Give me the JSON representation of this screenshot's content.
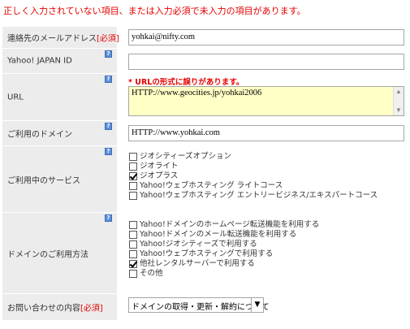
{
  "error_message": "正しく入力されていない項目、または入力必須で未入力の項目があります。",
  "required_mark": "[必須]",
  "help_glyph": "?",
  "fields": {
    "email": {
      "label": "連絡先のメールアドレス",
      "value": "yohkai@nifty.com"
    },
    "yahoo_id": {
      "label": "Yahoo! JAPAN ID",
      "value": ""
    },
    "url": {
      "label": "URL",
      "error": "* URLの形式に誤りがあります。",
      "value": "HTTP://www.geocities.jp/yohkai2006"
    },
    "domain": {
      "label": "ご利用のドメイン",
      "value": "HTTP://www.yohkai.com"
    },
    "services": {
      "label": "ご利用中のサービス",
      "options": [
        {
          "label": "ジオシティーズオプション",
          "checked": false
        },
        {
          "label": "ジオライト",
          "checked": false
        },
        {
          "label": "ジオプラス",
          "checked": true
        },
        {
          "label": "Yahoo!ウェブホスティング ライトコース",
          "checked": false
        },
        {
          "label": "Yahoo!ウェブホスティング エントリービジネス/エキスパートコース",
          "checked": false
        }
      ]
    },
    "domain_usage": {
      "label": "ドメインのご利用方法",
      "options": [
        {
          "label": "Yahoo!ドメインのホームページ転送機能を利用する",
          "checked": false
        },
        {
          "label": "Yahoo!ドメインのメール転送機能を利用する",
          "checked": false
        },
        {
          "label": "Yahoo!ジオシティーズで利用する",
          "checked": false
        },
        {
          "label": "Yahoo!ウェブホスティングで利用する",
          "checked": false
        },
        {
          "label": "他社レンタルサーバーで利用する",
          "checked": true
        },
        {
          "label": "その他",
          "checked": false
        }
      ]
    },
    "inquiry": {
      "label": "お問い合わせの内容",
      "selected": "ドメインの取得・更新・解約について"
    }
  }
}
